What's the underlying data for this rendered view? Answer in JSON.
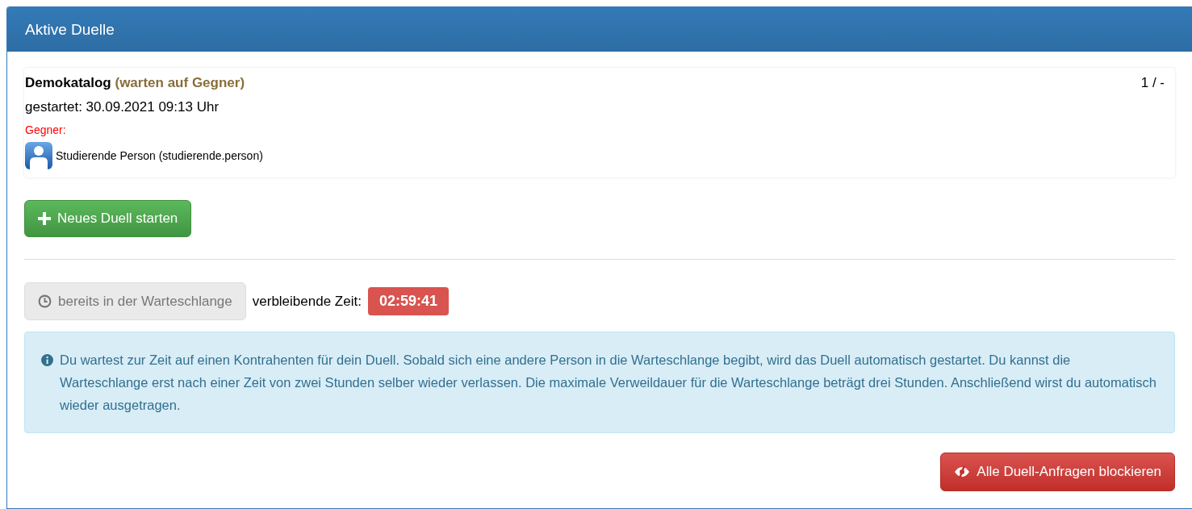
{
  "panel": {
    "title": "Aktive Duelle"
  },
  "duels": [
    {
      "catalog": "Demokatalog",
      "status": "(warten auf Gegner)",
      "started": "gestartet: 30.09.2021 09:13 Uhr",
      "round": "1 / -",
      "opponent_label": "Gegner:",
      "opponent": "Studierende Person (studierende.person)"
    }
  ],
  "new_duel_button": {
    "label": "Neues Duell starten"
  },
  "queue": {
    "button": {
      "label": "bereits in der Warteschlange",
      "disabled": true
    },
    "remaining_label": "verbleibende Zeit:",
    "remaining_time": "02:59:41"
  },
  "info_alert": "Du wartest zur Zeit auf einen Kontrahenten für dein Duell. Sobald sich eine andere Person in die Warteschlange begibt, wird das Duell automatisch gestartet. Du kannst die Warteschlange erst nach einer Zeit von zwei Stunden selber wieder verlassen. Die maximale Verweildauer für die Warteschlange beträgt drei Stunden. Anschließend wirst du automatisch wieder ausgetragen.",
  "block_button": {
    "label": "Alle Duell-Anfragen blockieren"
  }
}
